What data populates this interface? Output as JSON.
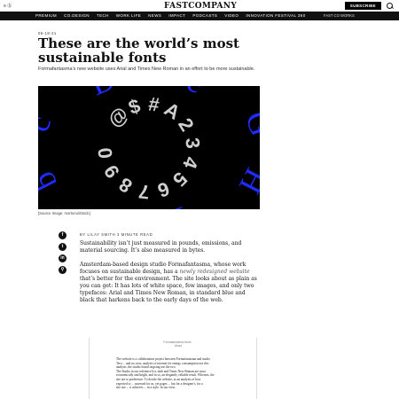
{
  "header": {
    "menu_label": "≡ Ⓢ",
    "logo": "FASTCOMPANY",
    "subscribe_label": "SUBSCRIBE"
  },
  "nav": {
    "items": [
      "PREMIUM",
      "CO.DESIGN",
      "TECH",
      "WORK LIFE",
      "NEWS",
      "IMPACT",
      "PODCASTS",
      "VIDEO",
      "INNOVATION FESTIVAL 360"
    ],
    "promo": "FAST CO WORKS"
  },
  "article": {
    "date": "05-18-21",
    "title": "These are the world’s most sustainable fonts",
    "dek": "Formafantasma’s new website uses Arial and Times New Roman in an effort to be more sustainable.",
    "hero_glyphs": [
      "@",
      "$",
      "#",
      "A",
      "2",
      "3",
      "4",
      "5",
      "6",
      "7",
      "8",
      "9",
      "0",
      "b",
      "c",
      "D",
      "e",
      "G",
      "H",
      "i"
    ],
    "caption": "[Source Image: mortoriu/iStock]",
    "byline": "BY LILAY SMITH  3 MINUTE READ",
    "paragraphs": [
      "Sustainability isn’t just measured in pounds, emissions, and material sourcing. It’s also measured in bytes.",
      "Amsterdam-based design studio Formafantasma, whose work focuses on sustainable design, has a",
      "newly redesigned website",
      " that’s better for the environment. The site looks about as plain as you can get: It has lots of white space, few images, and only two typefaces: Arial and Times New Roman, in standard blue and black that harkens back to the early days of the web."
    ]
  },
  "share": [
    "f",
    "t",
    "in",
    "⚲"
  ],
  "embed": {
    "head": "Formafantasma\nhome · About",
    "lines": [
      "The website is a collaboration project between Formafantasma and studio",
      "Tero ... and no, new, analysis of internet for energy consumption use this",
      "analysis, the studio found ongoing use the two",
      "The Studio in our reference list, dark and Times New Roman are most",
      "economically and bright, and in so, an elegantly, reliable result. Whereas, the",
      "site are to preference. To decide the website, as an analysis of how",
      "expected to ... assessed for us, yet pages ... but for a designer's, for a",
      "site use ... it achieves ... in a style. In our view."
    ]
  }
}
